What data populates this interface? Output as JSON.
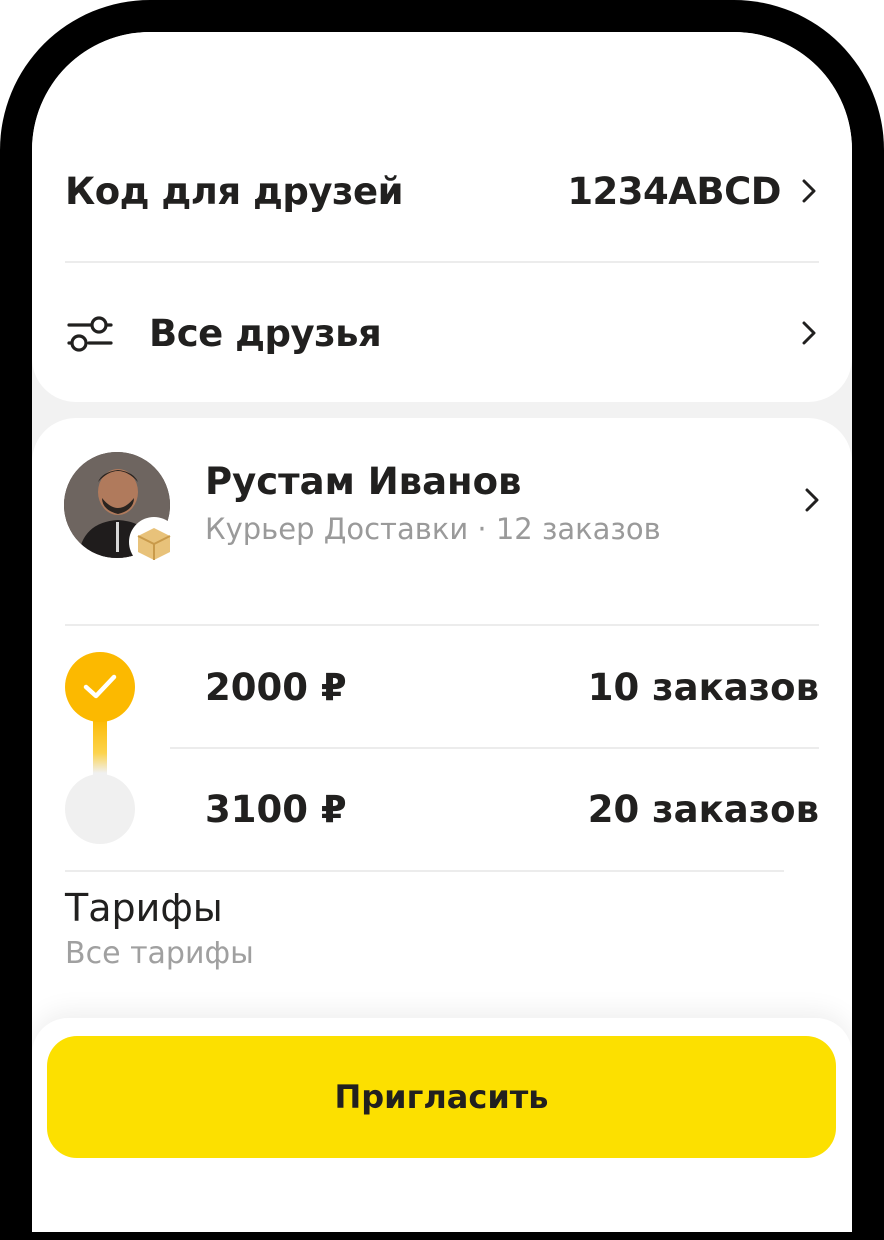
{
  "referral": {
    "code_label": "Код для друзей",
    "code_value": "1234ABCD",
    "friends_label": "Все друзья"
  },
  "friend": {
    "name": "Рустам Иванов",
    "subtitle": "Курьер Доставки · 12 заказов"
  },
  "rewards": [
    {
      "amount": "2000 ₽",
      "orders": "10 заказов",
      "completed": true
    },
    {
      "amount": "3100 ₽",
      "orders": "20 заказов",
      "completed": false
    }
  ],
  "tariffs": {
    "title": "Тарифы",
    "subtitle": "Все тарифы"
  },
  "actions": {
    "invite_label": "Пригласить"
  },
  "colors": {
    "accent": "#fce000",
    "step_done": "#fcb900",
    "step_pending": "#f0f0f0",
    "text_primary": "#21201f",
    "text_secondary": "#9a9a9a"
  },
  "icons": {
    "chevron": "chevron-right-icon",
    "filter": "filter-icon",
    "check": "check-icon",
    "badge": "box-badge-icon"
  }
}
